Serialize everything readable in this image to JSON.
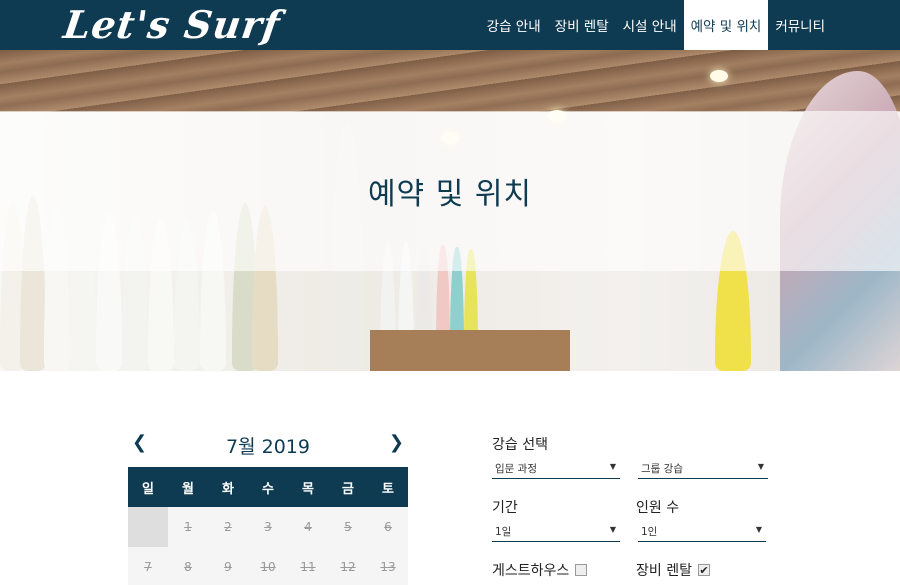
{
  "header": {
    "logo_text": "Let's Surf",
    "nav": [
      {
        "label": "강습 안내"
      },
      {
        "label": "장비 렌탈"
      },
      {
        "label": "시설 안내"
      },
      {
        "label": "예약 및 위치",
        "active": true
      },
      {
        "label": "커뮤니티"
      }
    ]
  },
  "hero": {
    "title": "예약 및 위치"
  },
  "calendar": {
    "prev_icon": "chevron-left",
    "next_icon": "chevron-right",
    "month_label": "7월 2019",
    "weekdays": [
      "일",
      "월",
      "화",
      "수",
      "목",
      "금",
      "토"
    ],
    "week1": [
      "",
      "1",
      "2",
      "3",
      "4",
      "5",
      "6"
    ],
    "week2": [
      "7",
      "8",
      "9",
      "10",
      "11",
      "12",
      "13"
    ]
  },
  "form": {
    "lesson_label": "강습 선택",
    "course_value": "입문 과정",
    "group_value": "그룹 강습",
    "period_label": "기간",
    "period_value": "1일",
    "people_label": "인원 수",
    "people_value": "1인",
    "guesthouse_label": "게스트하우스",
    "guesthouse_checked": false,
    "rental_label": "장비 렌탈",
    "rental_checked": true
  },
  "colors": {
    "primary": "#0f3b52",
    "background": "#ffffff"
  }
}
